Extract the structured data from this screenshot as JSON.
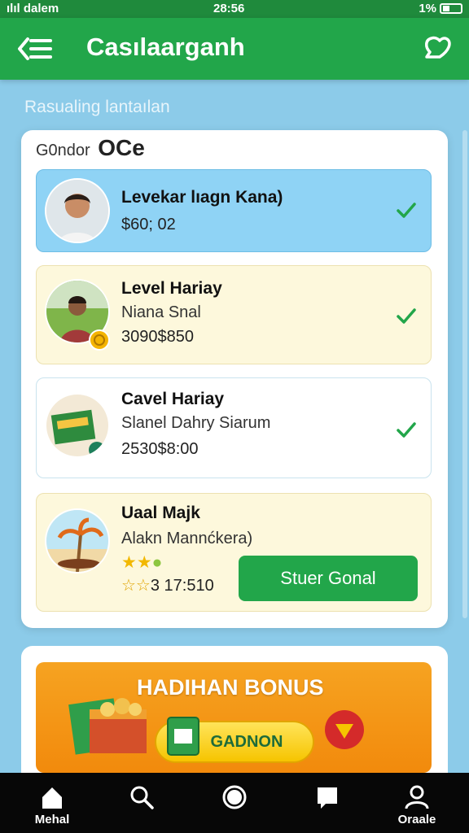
{
  "status_bar": {
    "carrier": "ılıl dalem",
    "time": "28:56",
    "right": "1%"
  },
  "app_bar": {
    "title": "Casılaarganh",
    "back_icon": "menu-back-icon",
    "action_icon": "chat-heart-icon"
  },
  "section_label": "Rasualing lantaılan",
  "list_header": {
    "label": "G0ndor",
    "accent": "OCe"
  },
  "items": [
    {
      "name": "Levekar lıagn Kana)",
      "value": "$60; 02",
      "selected": true,
      "avatar": "person-avatar"
    },
    {
      "name": "Level Hariay",
      "subtitle": "Niana Snal",
      "value": "3090$850",
      "avatar": "woman-field-avatar"
    },
    {
      "name": "Cavel Hariay",
      "subtitle": "Slanel Dahry Siarum",
      "value": "2530$8:00",
      "avatar": "sign-board-avatar"
    },
    {
      "name": "Uaal Majk",
      "subtitle": "Alakn Mannćkera)",
      "rating_value": "3 17:510",
      "stars_filled": 3,
      "button": "Stuer Gonal",
      "avatar": "palm-beach-avatar"
    }
  ],
  "bonus": {
    "title": "HADIHAN BONUS",
    "button": "GADNON"
  },
  "bottom_nav": [
    {
      "label": "Mehal",
      "icon": "home-icon"
    },
    {
      "label": "",
      "icon": "search-icon"
    },
    {
      "label": "",
      "icon": "circle-icon"
    },
    {
      "label": "",
      "icon": "square-icon"
    },
    {
      "label": "Oraale",
      "icon": "profile-icon"
    }
  ],
  "colors": {
    "primary": "#22a64a",
    "selected": "#8fd3f5",
    "cream": "#fdf8dc",
    "bonus": "#f28a0c",
    "background": "#8ccbe9"
  }
}
